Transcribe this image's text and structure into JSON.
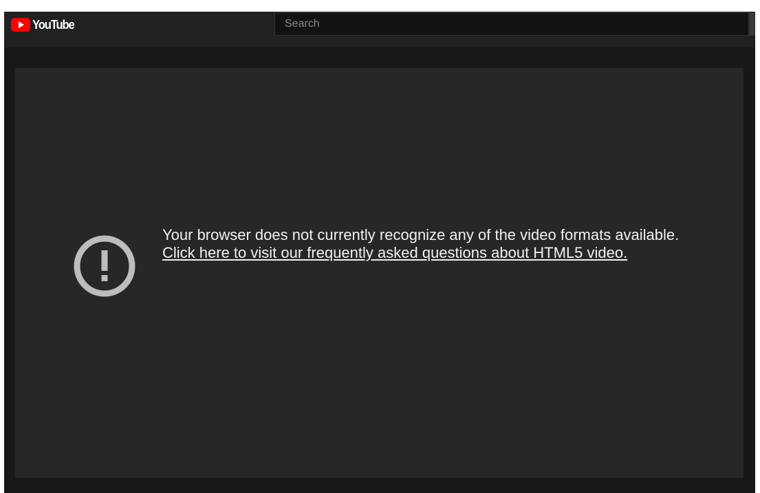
{
  "header": {
    "logo_text": "YouTube",
    "search": {
      "placeholder": "Search",
      "value": ""
    }
  },
  "player": {
    "error_message": "Your browser does not currently recognize any of the video formats available.",
    "help_link": "Click here to visit our frequently asked questions about HTML5 video.",
    "icon": "alert-circle-icon"
  },
  "colors": {
    "brand_red": "#ff0000",
    "masthead_bg": "#212121",
    "player_bg": "#272727",
    "text": "#f1f1f1",
    "icon_gray": "#bdbdbd"
  }
}
